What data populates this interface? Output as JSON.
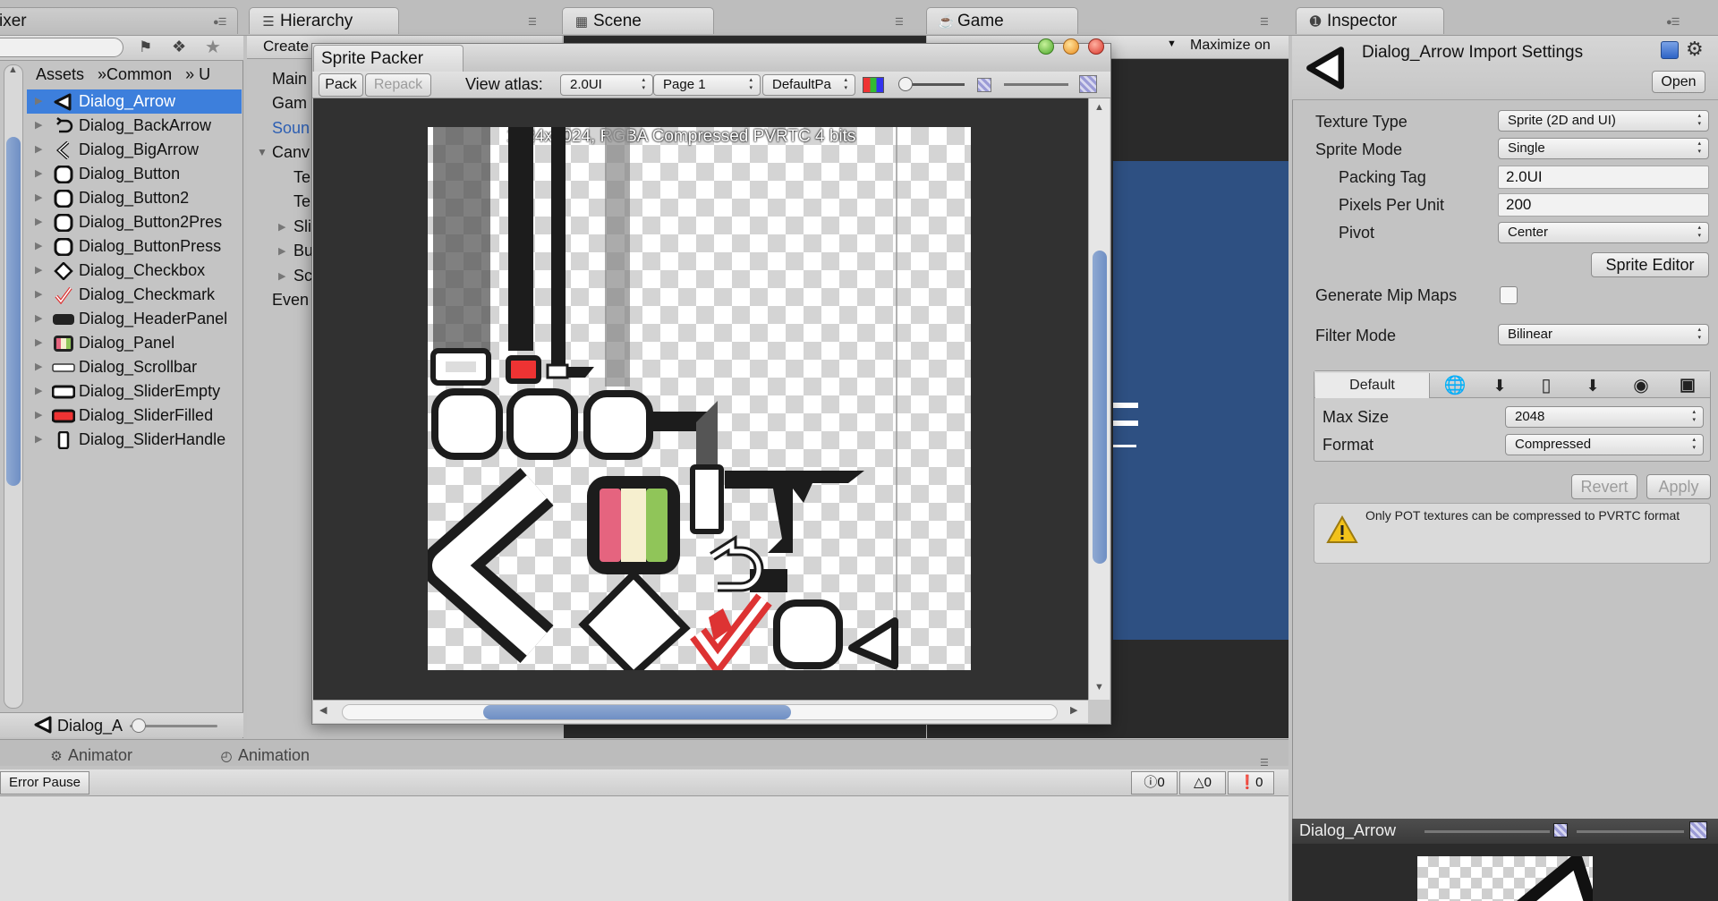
{
  "tabs": {
    "mixer": "ixer",
    "hierarchy": "Hierarchy",
    "scene": "Scene",
    "game": "Game",
    "inspector": "Inspector",
    "animator": "Animator",
    "animation": "Animation"
  },
  "project": {
    "breadcrumb": [
      "Assets",
      "»Common",
      "» U"
    ],
    "items": [
      {
        "label": "Dialog_Arrow",
        "icon": "arrow-sprite-icon"
      },
      {
        "label": "Dialog_BackArrow",
        "icon": "back-arrow-sprite-icon"
      },
      {
        "label": "Dialog_BigArrow",
        "icon": "big-arrow-sprite-icon"
      },
      {
        "label": "Dialog_Button",
        "icon": "button-sprite-icon"
      },
      {
        "label": "Dialog_Button2",
        "icon": "button2-sprite-icon"
      },
      {
        "label": "Dialog_Button2Pres",
        "icon": "button2-pressed-sprite-icon"
      },
      {
        "label": "Dialog_ButtonPress",
        "icon": "button-pressed-sprite-icon"
      },
      {
        "label": "Dialog_Checkbox",
        "icon": "checkbox-sprite-icon"
      },
      {
        "label": "Dialog_Checkmark",
        "icon": "checkmark-sprite-icon"
      },
      {
        "label": "Dialog_HeaderPanel",
        "icon": "header-panel-sprite-icon"
      },
      {
        "label": "Dialog_Panel",
        "icon": "panel-sprite-icon"
      },
      {
        "label": "Dialog_Scrollbar",
        "icon": "scrollbar-sprite-icon"
      },
      {
        "label": "Dialog_SliderEmpty",
        "icon": "slider-empty-sprite-icon"
      },
      {
        "label": "Dialog_SliderFilled",
        "icon": "slider-filled-sprite-icon"
      },
      {
        "label": "Dialog_SliderHandle",
        "icon": "slider-handle-sprite-icon"
      }
    ],
    "footer_label": "Dialog_A"
  },
  "hierarchy": {
    "create": "Create",
    "rows": [
      "Main",
      "Gam",
      "Soun",
      "Canv",
      "Te",
      "Te",
      "Sli",
      "Bu",
      "Sc",
      "Even"
    ]
  },
  "sprite_packer": {
    "title": "Sprite Packer",
    "pack": "Pack",
    "repack": "Repack",
    "view_atlas_label": "View atlas:",
    "atlas": "2.0UI",
    "page": "Page 1",
    "policy": "DefaultPa",
    "atlas_info": "1024x1024, RGBA Compressed PVRTC 4 bits"
  },
  "game": {
    "maximize": "Maximize on"
  },
  "inspector": {
    "title": "Dialog_Arrow Import Settings",
    "open": "Open",
    "texture_type_label": "Texture Type",
    "texture_type": "Sprite (2D and UI)",
    "sprite_mode_label": "Sprite Mode",
    "sprite_mode": "Single",
    "packing_tag_label": "Packing Tag",
    "packing_tag": "2.0UI",
    "ppu_label": "Pixels Per Unit",
    "ppu": "200",
    "pivot_label": "Pivot",
    "pivot": "Center",
    "sprite_editor": "Sprite Editor",
    "mipmaps_label": "Generate Mip Maps",
    "filter_label": "Filter Mode",
    "filter": "Bilinear",
    "platform_default": "Default",
    "max_size_label": "Max Size",
    "max_size": "2048",
    "format_label": "Format",
    "format": "Compressed",
    "revert": "Revert",
    "apply": "Apply",
    "warning": "Only POT textures can be compressed to PVRTC format",
    "preview_title": "Dialog_Arrow"
  },
  "console": {
    "error_pause": "Error Pause",
    "errors": "0",
    "warnings": "0",
    "infos": "0"
  },
  "colors": {
    "selection": "#3d7fdc",
    "scene_blue": "#2e5082",
    "packer_bg": "#313131"
  }
}
